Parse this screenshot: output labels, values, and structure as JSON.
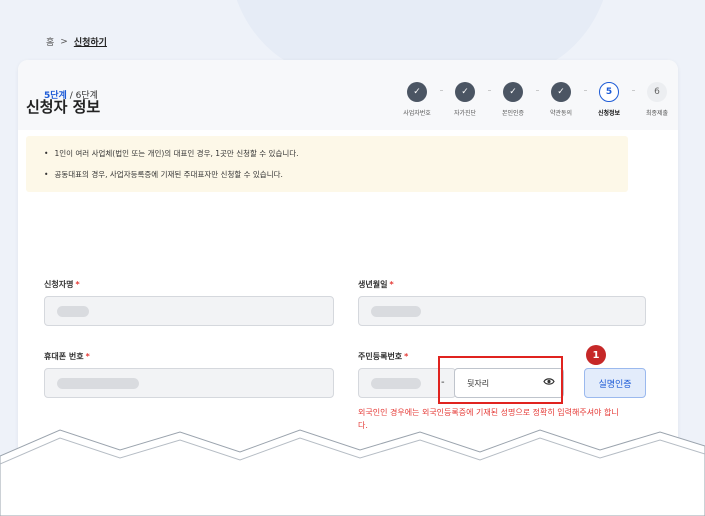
{
  "breadcrumb": {
    "home": "홈",
    "separator": ">",
    "current": "신청하기"
  },
  "progress": {
    "current_step": "5단계",
    "total_steps": "/ 6단계",
    "steps": [
      {
        "number": "✓",
        "label": "사업자번호",
        "status": "done"
      },
      {
        "number": "✓",
        "label": "자가진단",
        "status": "done"
      },
      {
        "number": "✓",
        "label": "본인인증",
        "status": "done"
      },
      {
        "number": "✓",
        "label": "약관동의",
        "status": "done"
      },
      {
        "number": "5",
        "label": "신청정보",
        "status": "active"
      },
      {
        "number": "6",
        "label": "최종제출",
        "status": "todo"
      }
    ],
    "connector": "···"
  },
  "section": {
    "title": "신청자 정보"
  },
  "notice": {
    "items": [
      "1인이 여러 사업체(법인 또는 개인)의 대표인 경우, 1곳만 신청할 수 있습니다.",
      "공동대표의 경우, 사업자등록증에 기재된 주대표자만 신청할 수 있습니다."
    ]
  },
  "form": {
    "applicant_name": {
      "label": "신청자명",
      "required_mark": "*"
    },
    "birth_date": {
      "label": "생년월일",
      "required_mark": "*"
    },
    "phone": {
      "label": "휴대폰 번호",
      "required_mark": "*"
    },
    "rrn": {
      "label": "주민등록번호",
      "required_mark": "*",
      "separator": "-",
      "back_placeholder": "뒷자리"
    },
    "verify_button": "실명인증",
    "warning": "외국인인 경우에는 외국인등록증에 기재된 성명으로 정확히 입력해주셔야 합니다."
  },
  "annotation": {
    "badge": "1"
  },
  "colors": {
    "accent": "#1d5bd6",
    "highlight": "#e0231f",
    "required": "#e53935",
    "notice_bg": "#fdf8e8"
  }
}
